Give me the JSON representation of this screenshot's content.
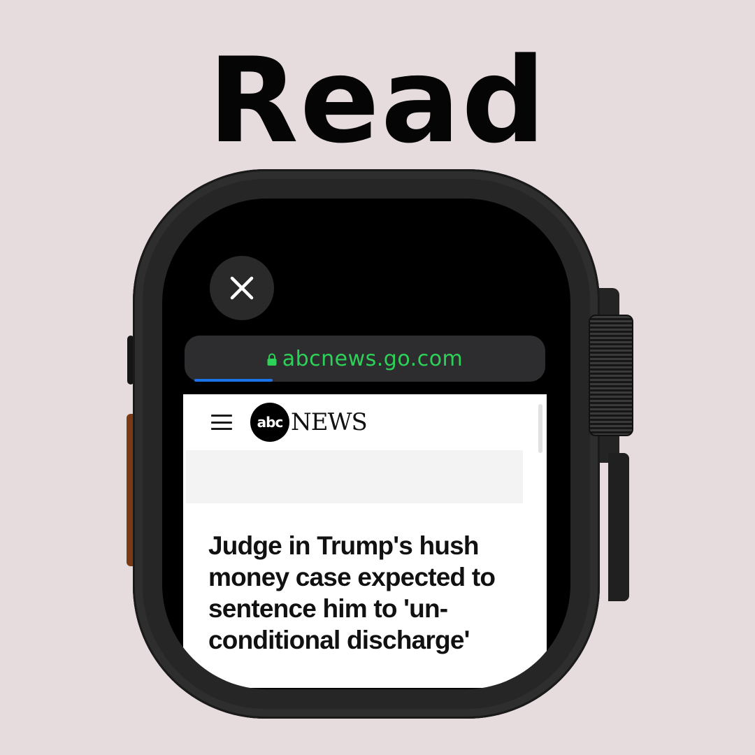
{
  "banner": {
    "title": "Read"
  },
  "watch": {
    "close_icon": "close-icon",
    "url_bar": {
      "lock_icon": "lock-icon",
      "url": "abcnews.go.com",
      "url_color": "#2ed158",
      "load_progress": 0.23
    },
    "web_page": {
      "menu_icon": "hamburger-menu-icon",
      "logo_circle_text": "abc",
      "logo_wordmark": "NEWS",
      "headline": "Judge in Trump's hush money case expected to sentence him to 'un-conditional discharge'"
    }
  }
}
